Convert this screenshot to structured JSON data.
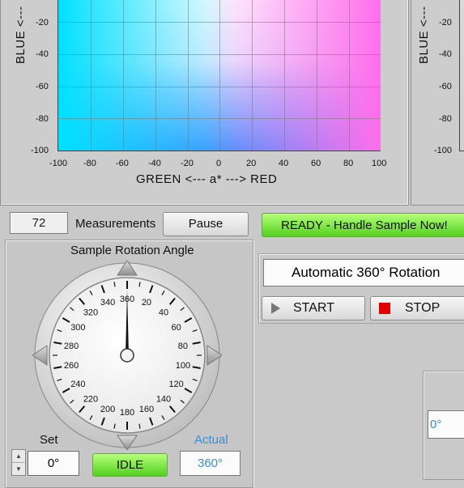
{
  "chart": {
    "ylabel": "BLUE <---",
    "xlabel": "GREEN <--- a* ---> RED",
    "y_ticks": [
      "-20",
      "-40",
      "-60",
      "-80",
      "-100"
    ],
    "x_ticks": [
      "-100",
      "-80",
      "-60",
      "-40",
      "-20",
      "0",
      "20",
      "40",
      "60",
      "80",
      "100"
    ]
  },
  "chart2": {
    "ylabel": "BLUE <---",
    "y_ticks": [
      "-20",
      "-40",
      "-60",
      "-80",
      "-100"
    ]
  },
  "measurements": {
    "count": "72",
    "label": "Measurements"
  },
  "pause_button": "Pause",
  "status_indicator": "READY - Handle Sample Now!",
  "mode_display": "Automatic 360° Rotation",
  "start_button": "START",
  "stop_button": "STOP",
  "gauge": {
    "title": "Sample Rotation Angle",
    "labels": [
      "360",
      "20",
      "40",
      "60",
      "80",
      "100",
      "120",
      "140",
      "160",
      "180",
      "200",
      "220",
      "240",
      "260",
      "280",
      "300",
      "320",
      "340"
    ],
    "needle_angle_deg": 360
  },
  "set": {
    "label": "Set",
    "value": "0°"
  },
  "idle_indicator": "IDLE",
  "actual": {
    "label": "Actual",
    "value": "360°"
  },
  "right_partial_value": "0°",
  "colors": {
    "accent_blue": "#3b8fd6",
    "status_green": "#66dd33",
    "stop_red": "#e00000"
  }
}
